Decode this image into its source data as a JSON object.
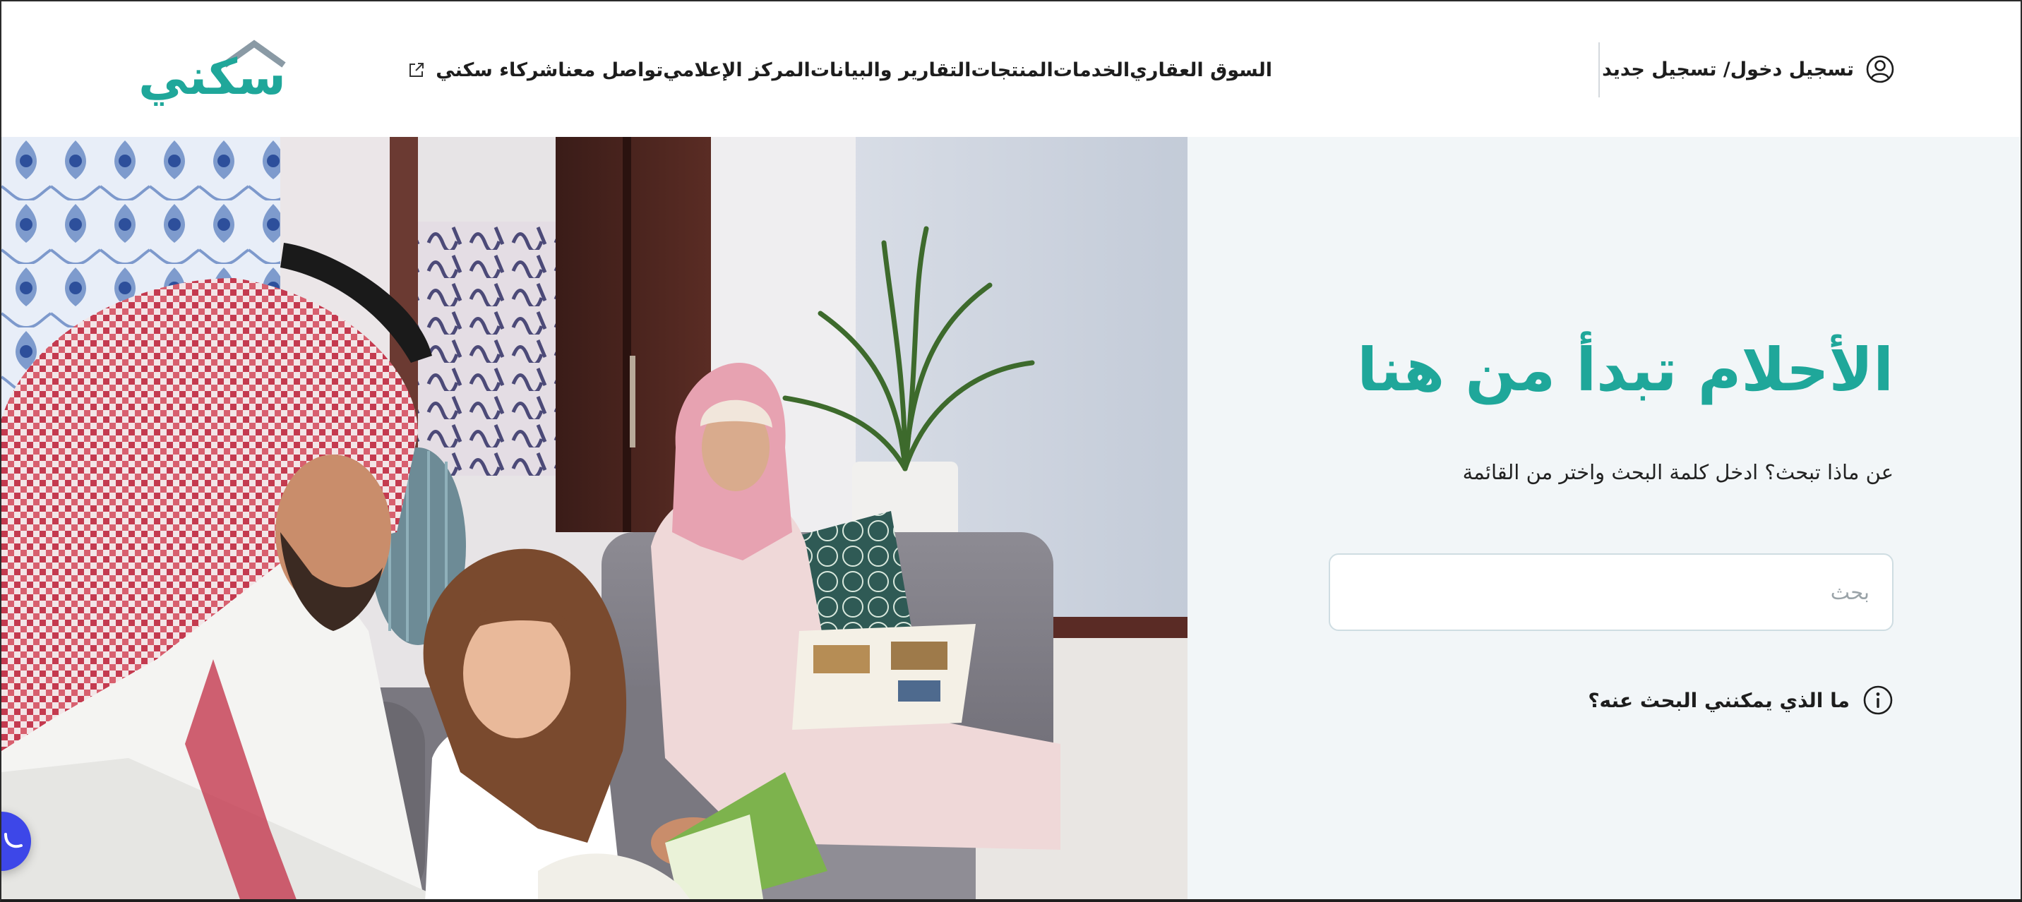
{
  "brand": {
    "logo_text": "سكني",
    "color_primary": "#1fa79a",
    "color_roof": "#8a9aa5"
  },
  "header": {
    "login_label": "تسجيل دخول/ تسجيل جديد",
    "nav": [
      {
        "label": "السوق العقاري"
      },
      {
        "label": "الخدمات"
      },
      {
        "label": "المنتجات"
      },
      {
        "label": "التقارير والبيانات"
      },
      {
        "label": "المركز الإعلامي"
      },
      {
        "label": "تواصل معنا"
      },
      {
        "label": "شركاء سكني",
        "icon": "external-link-icon"
      }
    ]
  },
  "hero": {
    "headline": "الأحلام تبدأ من هنا",
    "subtitle": "عن ماذا تبحث؟ ادخل كلمة البحث واختر من القائمة",
    "search": {
      "placeholder": "بحث",
      "value": ""
    },
    "help_label": "ما الذي يمكنني البحث عنه؟"
  },
  "chat": {
    "icon": "chat-icon",
    "color": "#3d47e8"
  }
}
